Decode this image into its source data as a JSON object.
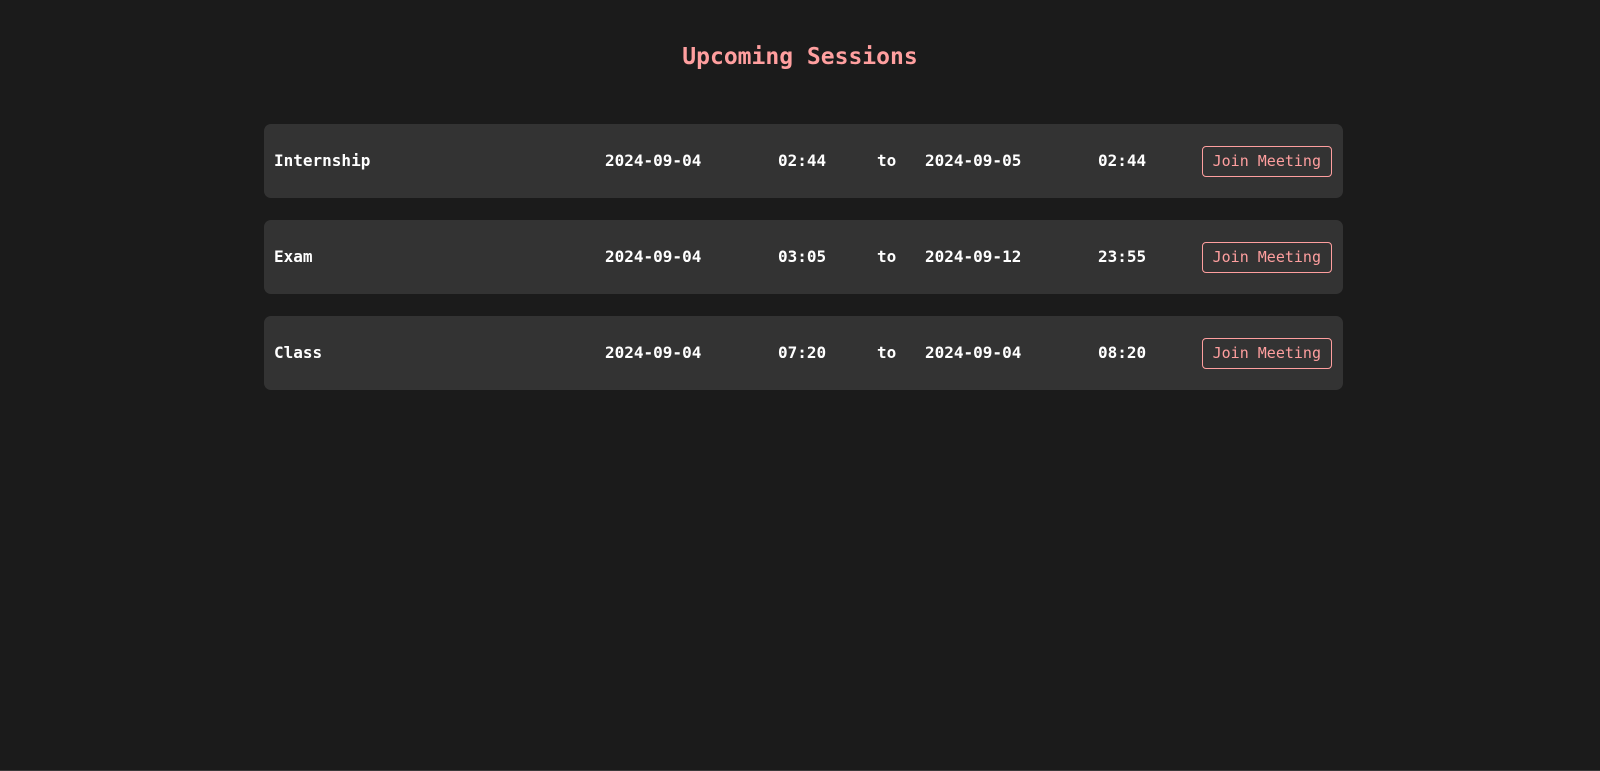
{
  "page": {
    "title": "Upcoming Sessions"
  },
  "colors": {
    "background": "#1b1b1b",
    "row_background": "#333333",
    "accent": "#ff9f9f",
    "text": "#ffffff"
  },
  "sessions": [
    {
      "name": "Internship",
      "start_date": "2024-09-04",
      "start_time": "02:44",
      "separator": "to",
      "end_date": "2024-09-05",
      "end_time": "02:44",
      "button_label": "Join Meeting"
    },
    {
      "name": "Exam",
      "start_date": "2024-09-04",
      "start_time": "03:05",
      "separator": "to",
      "end_date": "2024-09-12",
      "end_time": "23:55",
      "button_label": "Join Meeting"
    },
    {
      "name": "Class",
      "start_date": "2024-09-04",
      "start_time": "07:20",
      "separator": "to",
      "end_date": "2024-09-04",
      "end_time": "08:20",
      "button_label": "Join Meeting"
    }
  ]
}
